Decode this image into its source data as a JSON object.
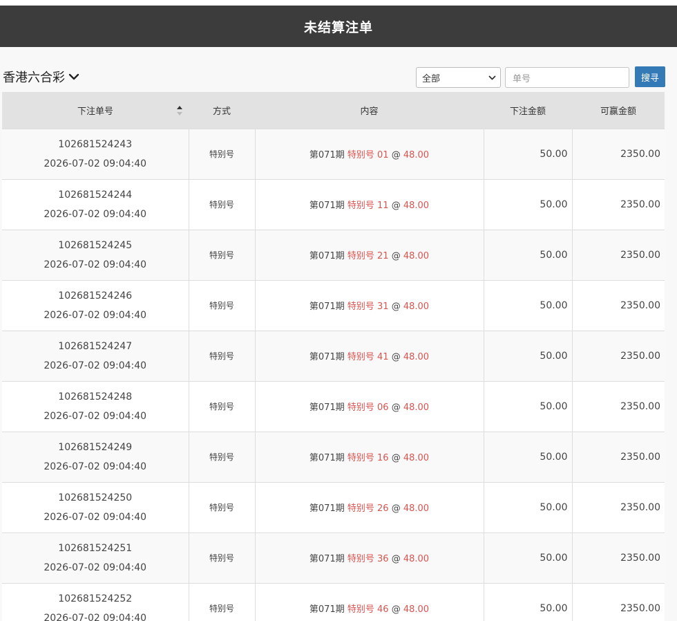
{
  "header": {
    "title": "未结算注单"
  },
  "toolbar": {
    "game_name": "香港六合彩",
    "filter_value": "全部",
    "order_placeholder": "单号",
    "search_label": "搜寻"
  },
  "table": {
    "columns": [
      "下注单号",
      "方式",
      "内容",
      "下注金额",
      "可赢金额"
    ],
    "rows": [
      {
        "order_no": "102681524243",
        "time": "2026-07-02 09:04:40",
        "method": "特别号",
        "period": "第071期",
        "play": "特别号",
        "number": "01",
        "at": "@",
        "odds": "48.00",
        "amount": "50.00",
        "win": "2350.00"
      },
      {
        "order_no": "102681524244",
        "time": "2026-07-02 09:04:40",
        "method": "特别号",
        "period": "第071期",
        "play": "特别号",
        "number": "11",
        "at": "@",
        "odds": "48.00",
        "amount": "50.00",
        "win": "2350.00"
      },
      {
        "order_no": "102681524245",
        "time": "2026-07-02 09:04:40",
        "method": "特别号",
        "period": "第071期",
        "play": "特别号",
        "number": "21",
        "at": "@",
        "odds": "48.00",
        "amount": "50.00",
        "win": "2350.00"
      },
      {
        "order_no": "102681524246",
        "time": "2026-07-02 09:04:40",
        "method": "特别号",
        "period": "第071期",
        "play": "特别号",
        "number": "31",
        "at": "@",
        "odds": "48.00",
        "amount": "50.00",
        "win": "2350.00"
      },
      {
        "order_no": "102681524247",
        "time": "2026-07-02 09:04:40",
        "method": "特别号",
        "period": "第071期",
        "play": "特别号",
        "number": "41",
        "at": "@",
        "odds": "48.00",
        "amount": "50.00",
        "win": "2350.00"
      },
      {
        "order_no": "102681524248",
        "time": "2026-07-02 09:04:40",
        "method": "特别号",
        "period": "第071期",
        "play": "特别号",
        "number": "06",
        "at": "@",
        "odds": "48.00",
        "amount": "50.00",
        "win": "2350.00"
      },
      {
        "order_no": "102681524249",
        "time": "2026-07-02 09:04:40",
        "method": "特别号",
        "period": "第071期",
        "play": "特别号",
        "number": "16",
        "at": "@",
        "odds": "48.00",
        "amount": "50.00",
        "win": "2350.00"
      },
      {
        "order_no": "102681524250",
        "time": "2026-07-02 09:04:40",
        "method": "特别号",
        "period": "第071期",
        "play": "特别号",
        "number": "26",
        "at": "@",
        "odds": "48.00",
        "amount": "50.00",
        "win": "2350.00"
      },
      {
        "order_no": "102681524251",
        "time": "2026-07-02 09:04:40",
        "method": "特别号",
        "period": "第071期",
        "play": "特别号",
        "number": "36",
        "at": "@",
        "odds": "48.00",
        "amount": "50.00",
        "win": "2350.00"
      },
      {
        "order_no": "102681524252",
        "time": "2026-07-02 09:04:40",
        "method": "特别号",
        "period": "第071期",
        "play": "特别号",
        "number": "46",
        "at": "@",
        "odds": "48.00",
        "amount": "50.00",
        "win": "2350.00"
      }
    ]
  },
  "colors": {
    "header_bg": "#3c3c3c",
    "accent_red": "#d9534f",
    "button_blue": "#337ab7",
    "table_head_bg": "#e2e2e2"
  },
  "icons": {
    "game_dropdown": "chevron-down-icon",
    "filter_dropdown": "chevron-down-icon",
    "sort": "sort-icon"
  }
}
